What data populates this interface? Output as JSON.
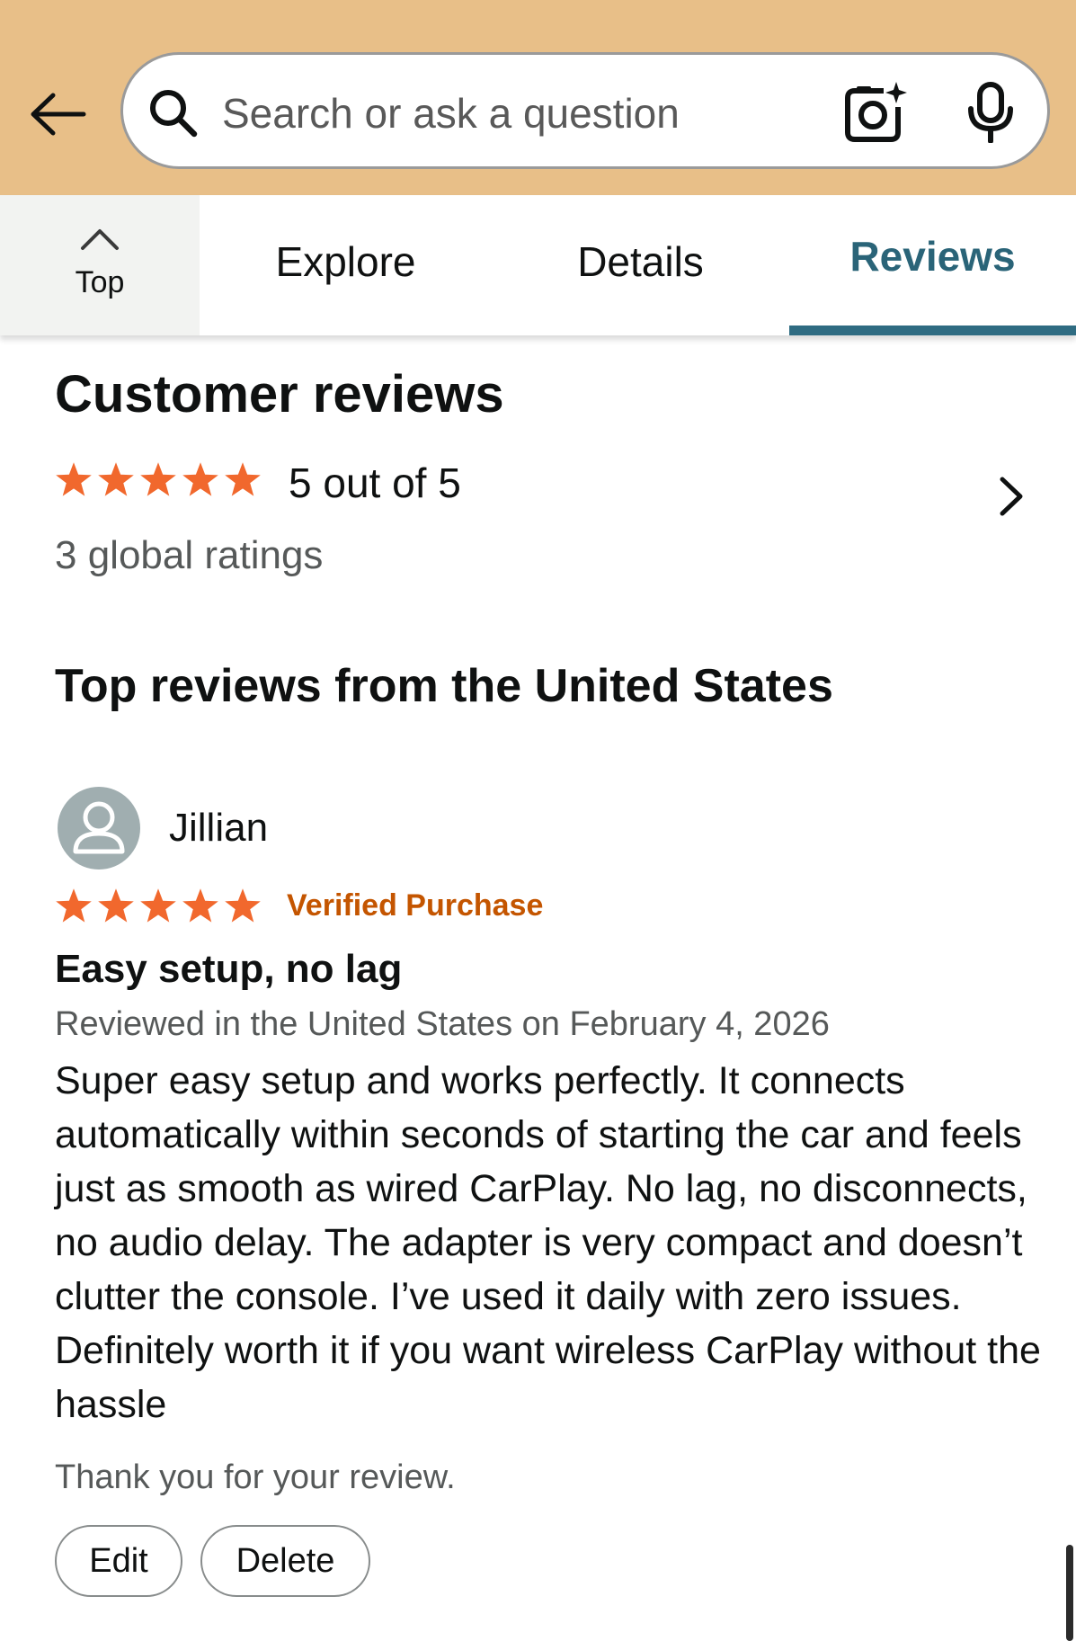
{
  "header": {
    "background_color": "#e8bf88",
    "back_icon": "arrow-left-icon",
    "search": {
      "placeholder": "Search or ask a question",
      "value": "",
      "search_icon": "search-icon",
      "camera_icon": "camera-sparkle-icon",
      "mic_icon": "microphone-icon"
    }
  },
  "tabs": {
    "top_label": "Top",
    "items": [
      {
        "label": "Explore",
        "active": false
      },
      {
        "label": "Details",
        "active": false
      },
      {
        "label": "Reviews",
        "active": true
      }
    ],
    "active_color": "#2f6c82"
  },
  "summary": {
    "title": "Customer reviews",
    "stars": 5,
    "rating_text": "5 out of 5",
    "global_ratings": "3 global ratings",
    "star_color": "#f1682d"
  },
  "top_reviews": {
    "title": "Top reviews from the United States",
    "review": {
      "reviewer": "Jillian",
      "stars": 5,
      "badge": "Verified Purchase",
      "badge_color": "#c45500",
      "title": "Easy setup, no lag",
      "date": "Reviewed in the United States on February 4, 2026",
      "body": "Super easy setup and works perfectly. It connects automatically within seconds of starting the car and feels just as smooth as wired CarPlay. No lag, no disconnects, no audio delay. The adapter is very compact and doesn’t clutter the console. I’ve used it daily with zero issues. Definitely worth it if you want wireless CarPlay without the hassle",
      "thanks": "Thank you for your review.",
      "edit_label": "Edit",
      "delete_label": "Delete"
    }
  }
}
